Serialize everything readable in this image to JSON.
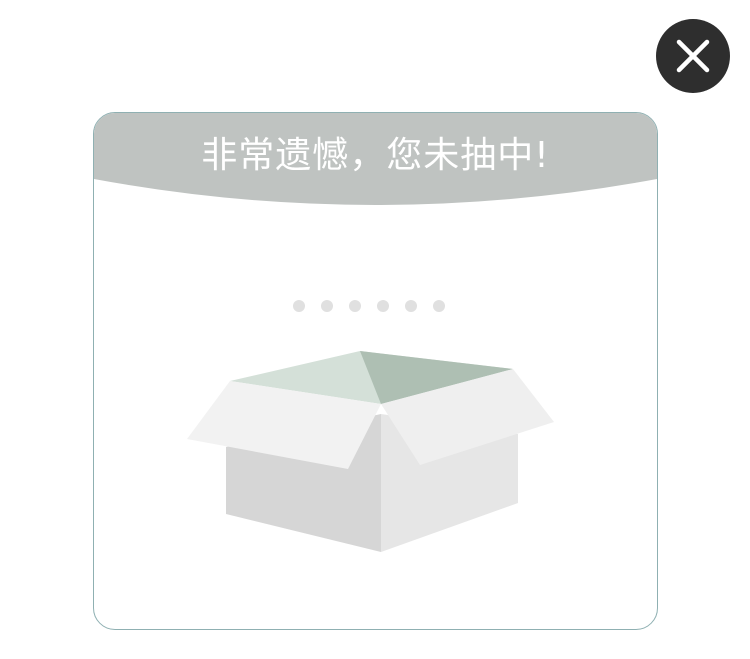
{
  "dialog": {
    "title": "非常遗憾，您未抽中!",
    "loading_dot_count": 6
  },
  "close_button": {
    "icon": "close-icon"
  },
  "illustration": {
    "icon": "open-empty-box-icon"
  },
  "colors": {
    "banner": "#bfc3c1",
    "border": "#8fb0b2",
    "close_bg": "#2e2e2e",
    "dot": "#e0e0e0",
    "box_light": "#f2f2f2",
    "box_side": "#e6e6e6",
    "box_front": "#d6d6d6",
    "box_inside": "#aebfb3"
  }
}
